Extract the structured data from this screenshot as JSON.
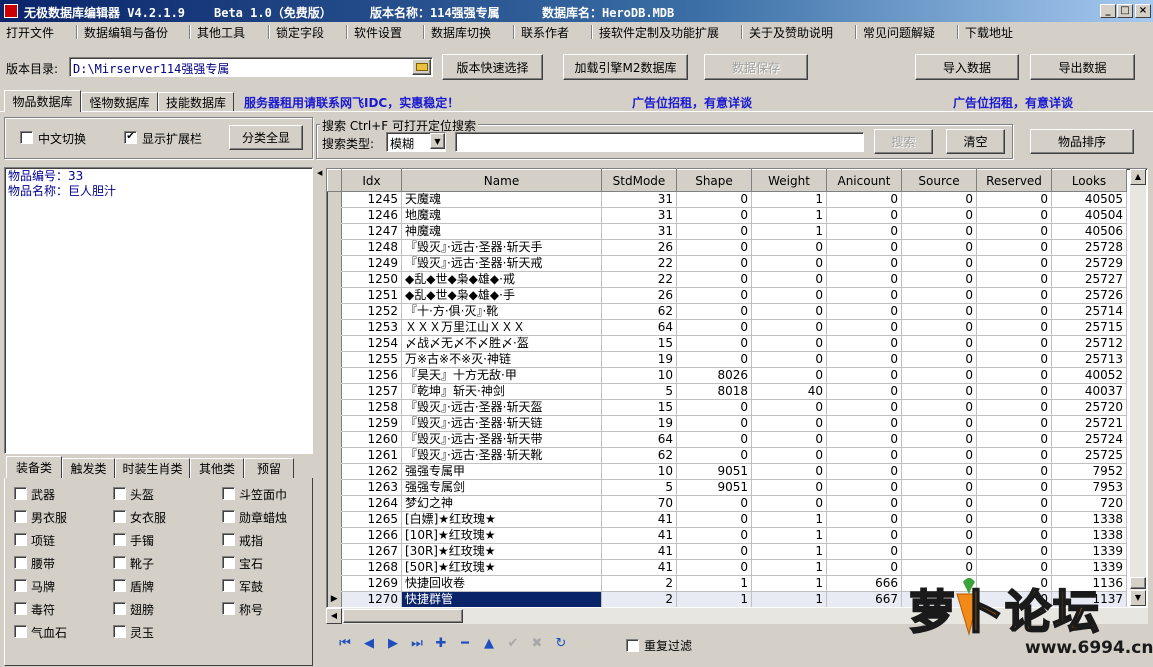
{
  "window": {
    "app_name": "无极数据库编辑器 V4.2.1.9",
    "edition": "Beta 1.0（免费版）",
    "version_name": "版本名称：114强强专属",
    "db_name": "数据库名：HeroDB.MDB",
    "minimize": "_",
    "maximize": "□",
    "close": "×"
  },
  "menu": [
    "打开文件",
    "数据编辑与备份",
    "其他工具",
    "锁定字段",
    "软件设置",
    "数据库切换",
    "联系作者",
    "接软件定制及功能扩展",
    "关于及赞助说明",
    "常见问题解疑",
    "下载地址"
  ],
  "toolbar": {
    "dir_label": "版本目录:",
    "dir_value": "D:\\Mirserver114强强专属",
    "quick_select": "版本快速选择",
    "load_engine": "加载引擎M2数据库",
    "save_data": "数据保存",
    "import_data": "导入数据",
    "export_data": "导出数据"
  },
  "db_tabs": [
    "物品数据库",
    "怪物数据库",
    "技能数据库"
  ],
  "ads": {
    "server": "服务器租用请联系网飞IDC，实惠稳定！",
    "ad1": "广告位招租，有意详谈",
    "ad2": "广告位招租，有意详谈"
  },
  "options": {
    "chinese_toggle": "中文切换",
    "show_ext": "显示扩展栏",
    "show_all": "分类全显",
    "chinese_checked": false,
    "show_ext_checked": true
  },
  "search": {
    "group_title": "搜索  Ctrl+F 可打开定位搜索",
    "type_label": "搜索类型:",
    "type_value": "模糊",
    "query": "",
    "search_btn": "搜索",
    "clear_btn": "清空",
    "sort_btn": "物品排序"
  },
  "item_detail": {
    "id_line": "物品编号：33",
    "name_line": "物品名称：巨人胆汁"
  },
  "category_tabs": [
    "装备类",
    "触发类",
    "时装生肖类",
    "其他类",
    "预留"
  ],
  "categories": [
    [
      "武器",
      "头盔",
      "斗笠面巾"
    ],
    [
      "男衣服",
      "女衣服",
      "勋章蜡烛"
    ],
    [
      "项链",
      "手镯",
      "戒指"
    ],
    [
      "腰带",
      "靴子",
      "宝石"
    ],
    [
      "马牌",
      "盾牌",
      "军鼓"
    ],
    [
      "毒符",
      "翅膀",
      "称号"
    ],
    [
      "气血石",
      "灵玉",
      ""
    ]
  ],
  "grid": {
    "columns": [
      "Idx",
      "Name",
      "StdMode",
      "Shape",
      "Weight",
      "Anicount",
      "Source",
      "Reserved",
      "Looks"
    ],
    "rows": [
      [
        "1245",
        "天魔魂",
        "31",
        "0",
        "1",
        "0",
        "0",
        "0",
        "40505"
      ],
      [
        "1246",
        "地魔魂",
        "31",
        "0",
        "1",
        "0",
        "0",
        "0",
        "40504"
      ],
      [
        "1247",
        "神魔魂",
        "31",
        "0",
        "1",
        "0",
        "0",
        "0",
        "40506"
      ],
      [
        "1248",
        "『毁灭』·远古·圣器·斩天手",
        "26",
        "0",
        "0",
        "0",
        "0",
        "0",
        "25728"
      ],
      [
        "1249",
        "『毁灭』·远古·圣器·斩天戒",
        "22",
        "0",
        "0",
        "0",
        "0",
        "0",
        "25729"
      ],
      [
        "1250",
        "◆乱◆世◆枭◆雄◆·戒",
        "22",
        "0",
        "0",
        "0",
        "0",
        "0",
        "25727"
      ],
      [
        "1251",
        "◆乱◆世◆枭◆雄◆·手",
        "26",
        "0",
        "0",
        "0",
        "0",
        "0",
        "25726"
      ],
      [
        "1252",
        "『十·方·俱·灭』·靴",
        "62",
        "0",
        "0",
        "0",
        "0",
        "0",
        "25714"
      ],
      [
        "1253",
        "ＸＸＸ万里江山ＸＸＸ",
        "64",
        "0",
        "0",
        "0",
        "0",
        "0",
        "25715"
      ],
      [
        "1254",
        "〆战〆无〆不〆胜〆·盔",
        "15",
        "0",
        "0",
        "0",
        "0",
        "0",
        "25712"
      ],
      [
        "1255",
        "万※古※不※灭·神链",
        "19",
        "0",
        "0",
        "0",
        "0",
        "0",
        "25713"
      ],
      [
        "1256",
        "『昊天』十方无敌·甲",
        "10",
        "8026",
        "0",
        "0",
        "0",
        "0",
        "40052"
      ],
      [
        "1257",
        "『乾坤』斩天·神剑",
        "5",
        "8018",
        "40",
        "0",
        "0",
        "0",
        "40037"
      ],
      [
        "1258",
        "『毁灭』·远古·圣器·斩天盔",
        "15",
        "0",
        "0",
        "0",
        "0",
        "0",
        "25720"
      ],
      [
        "1259",
        "『毁灭』·远古·圣器·斩天链",
        "19",
        "0",
        "0",
        "0",
        "0",
        "0",
        "25721"
      ],
      [
        "1260",
        "『毁灭』·远古·圣器·斩天带",
        "64",
        "0",
        "0",
        "0",
        "0",
        "0",
        "25724"
      ],
      [
        "1261",
        "『毁灭』·远古·圣器·斩天靴",
        "62",
        "0",
        "0",
        "0",
        "0",
        "0",
        "25725"
      ],
      [
        "1262",
        "强强专属甲",
        "10",
        "9051",
        "0",
        "0",
        "0",
        "0",
        "7952"
      ],
      [
        "1263",
        "强强专属剑",
        "5",
        "9051",
        "0",
        "0",
        "0",
        "0",
        "7953"
      ],
      [
        "1264",
        "梦幻之神",
        "70",
        "0",
        "0",
        "0",
        "0",
        "0",
        "720"
      ],
      [
        "1265",
        "[白嫖]★红玫瑰★",
        "41",
        "0",
        "1",
        "0",
        "0",
        "0",
        "1338"
      ],
      [
        "1266",
        "[10R]★红玫瑰★",
        "41",
        "0",
        "1",
        "0",
        "0",
        "0",
        "1338"
      ],
      [
        "1267",
        "[30R]★红玫瑰★",
        "41",
        "0",
        "1",
        "0",
        "0",
        "0",
        "1339"
      ],
      [
        "1268",
        "[50R]★红玫瑰★",
        "41",
        "0",
        "1",
        "0",
        "0",
        "0",
        "1339"
      ],
      [
        "1269",
        "快捷回收卷",
        "2",
        "1",
        "1",
        "666",
        "0",
        "0",
        "1136"
      ],
      [
        "1270",
        "快捷群管",
        "2",
        "1",
        "1",
        "667",
        "0",
        "0",
        "1137"
      ]
    ],
    "selected_index": 25,
    "row_marker": "▶"
  },
  "navigator": {
    "icons": [
      "nav-first-icon",
      "nav-prior-icon",
      "nav-next-icon",
      "nav-last-icon",
      "nav-insert-icon",
      "nav-delete-icon",
      "nav-edit-icon",
      "nav-post-icon",
      "nav-cancel-icon",
      "nav-refresh-icon"
    ],
    "dedupe_label": "重复过滤",
    "dedupe_checked": false
  },
  "watermark": {
    "logo_text": "萝卜论坛",
    "url": "www.6994.cn"
  },
  "colors": {
    "title_start": "#0a246a",
    "title_end": "#a6caf0",
    "selection": "#0a246a",
    "ad_text": "#1a1ad0",
    "face": "#d4d0c8",
    "watermark_orange": "#f28a1a"
  }
}
